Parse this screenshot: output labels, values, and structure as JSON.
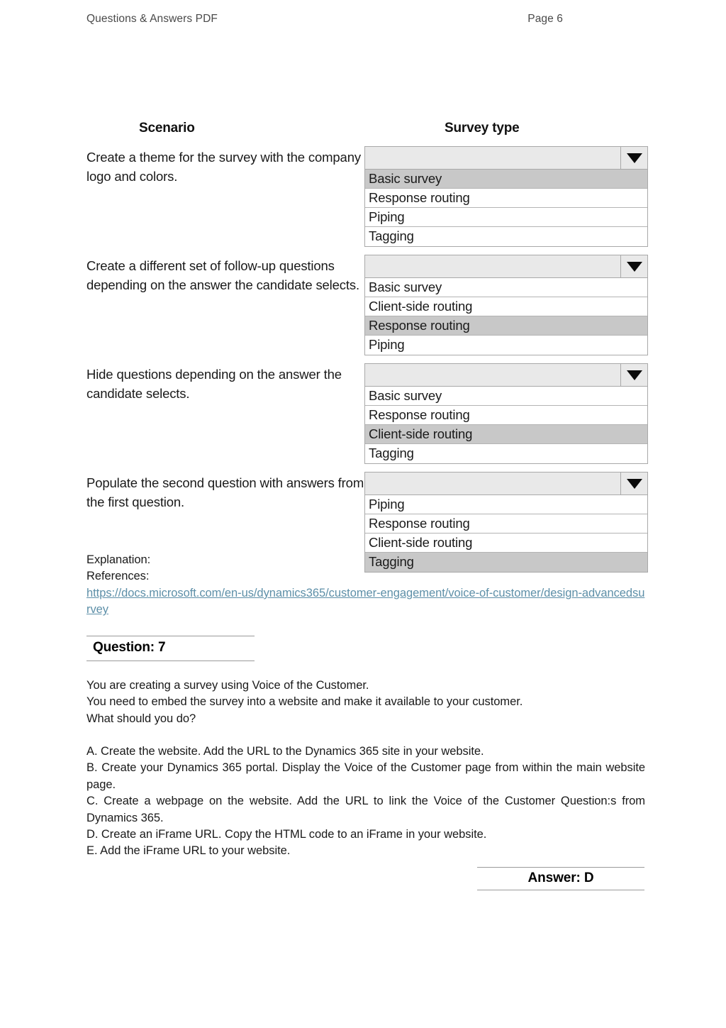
{
  "header": {
    "left_label": "Questions & Answers PDF",
    "right_label": "Page 6"
  },
  "exhibit": {
    "columns": {
      "scenario": "Scenario",
      "survey_type": "Survey type"
    },
    "rows": [
      {
        "scenario": "Create a theme for the survey with the company logo and colors.",
        "dropdown": {
          "selected": "Basic survey",
          "options": [
            "Basic survey",
            "Response routing",
            "Piping",
            "Tagging"
          ]
        }
      },
      {
        "scenario": "Create a different set of follow-up questions depending on the answer the candidate selects.",
        "dropdown": {
          "selected": "Response routing",
          "options": [
            "Basic survey",
            "Client-side routing",
            "Response routing",
            "Piping"
          ]
        }
      },
      {
        "scenario": "Hide questions depending on the answer the candidate selects.",
        "dropdown": {
          "selected": "Client-side routing",
          "options": [
            "Basic survey",
            "Response routing",
            "Client-side routing",
            "Tagging"
          ]
        }
      },
      {
        "scenario": "Populate the second question with answers from the first question.",
        "dropdown": {
          "selected": "Tagging",
          "options": [
            "Piping",
            "Response routing",
            "Client-side routing",
            "Tagging"
          ]
        }
      }
    ]
  },
  "explanation": {
    "explanation_label": "Explanation:",
    "references_label": "References:",
    "reference_url": "https://docs.microsoft.com/en-us/dynamics365/customer-engagement/voice-of-customer/design-advancedsurvey"
  },
  "question": {
    "heading": "Question: 7",
    "stem_lines": [
      "You are creating a survey using Voice of the Customer.",
      "You need to embed the survey into a website and make it available to your customer.",
      "What should you do?"
    ],
    "options": [
      "A. Create the website. Add the URL to the Dynamics 365 site in your website.",
      "B. Create your Dynamics 365 portal. Display the Voice of the Customer page from within the main website page.",
      "C. Create a webpage on the website. Add the URL to link the Voice of the Customer Question:s from Dynamics 365.",
      "D. Create an iFrame URL. Copy the HTML code to an iFrame in your website.",
      "E. Add the iFrame URL to your website."
    ]
  },
  "answer": {
    "label": "Answer: D"
  },
  "colors": {
    "link": "#5d8fa8",
    "selected_option_bg": "#c8c8c8",
    "combo_header_bg": "#e9e9e9",
    "border": "#a9a9a9"
  }
}
